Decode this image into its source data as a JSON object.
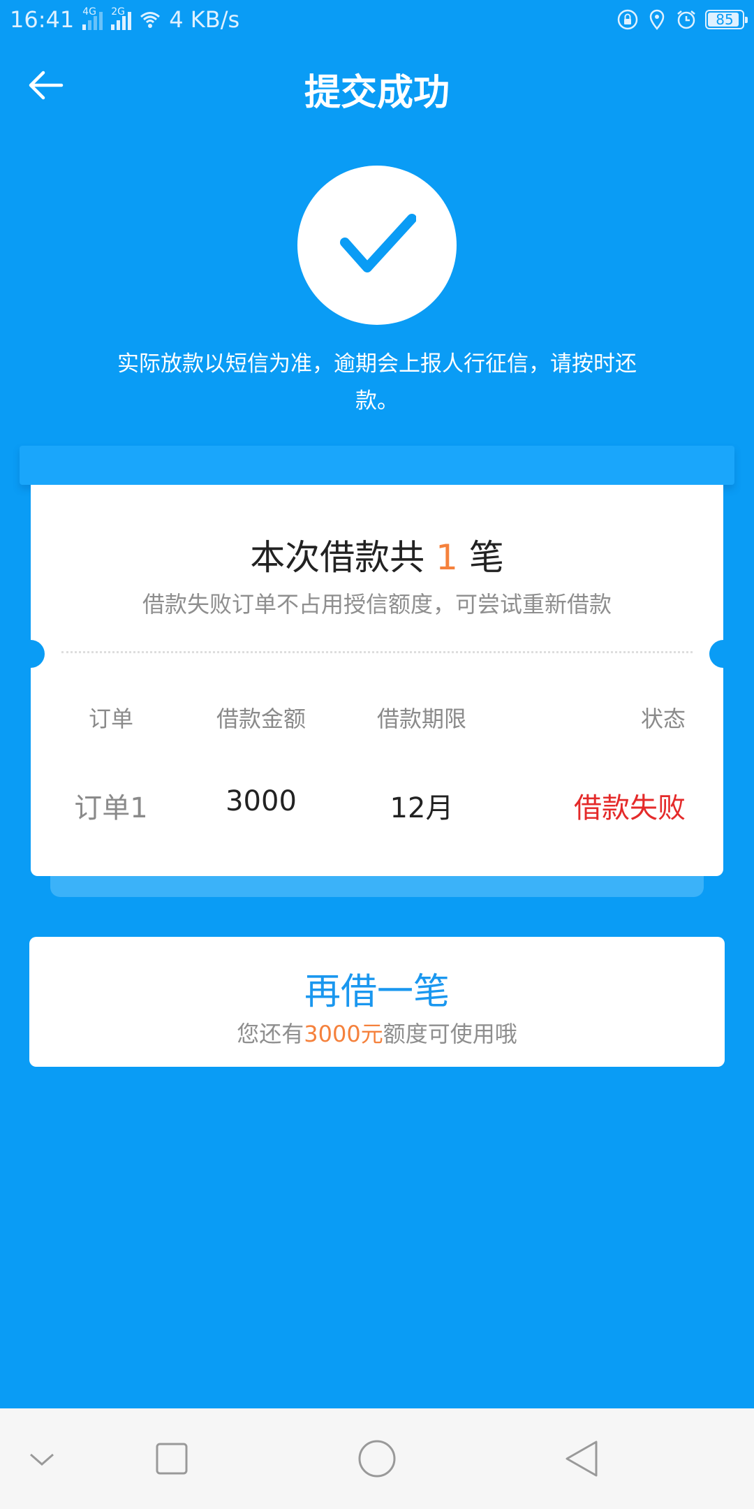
{
  "status_bar": {
    "time": "16:41",
    "net1": "4G",
    "net2": "2G",
    "speed": "4 KB/s",
    "battery": "85"
  },
  "header": {
    "title": "提交成功"
  },
  "notice": "实际放款以短信为准，逾期会上报人行征信，请按时还款。",
  "card": {
    "title_prefix": "本次借款共",
    "count": "1",
    "title_suffix": "笔",
    "subtitle": "借款失败订单不占用授信额度，可尝试重新借款",
    "columns": [
      "订单",
      "借款金额",
      "借款期限",
      "状态"
    ],
    "rows": [
      {
        "order": "订单1",
        "amount": "3000",
        "term": "12月",
        "status": "借款失败"
      }
    ]
  },
  "again": {
    "title": "再借一笔",
    "sub_prefix": "您还有",
    "sub_amount": "3000元",
    "sub_suffix": "额度可使用哦"
  },
  "colors": {
    "background": "#0a9cf5",
    "accent_orange": "#f5813c",
    "status_failed": "#e42a2a",
    "link_blue": "#1a97ef"
  },
  "icons": [
    "back-arrow-icon",
    "check-icon",
    "lock-icon",
    "location-icon",
    "alarm-icon",
    "wifi-icon",
    "nav-down-icon",
    "nav-recents-icon",
    "nav-home-icon",
    "nav-back-icon"
  ]
}
